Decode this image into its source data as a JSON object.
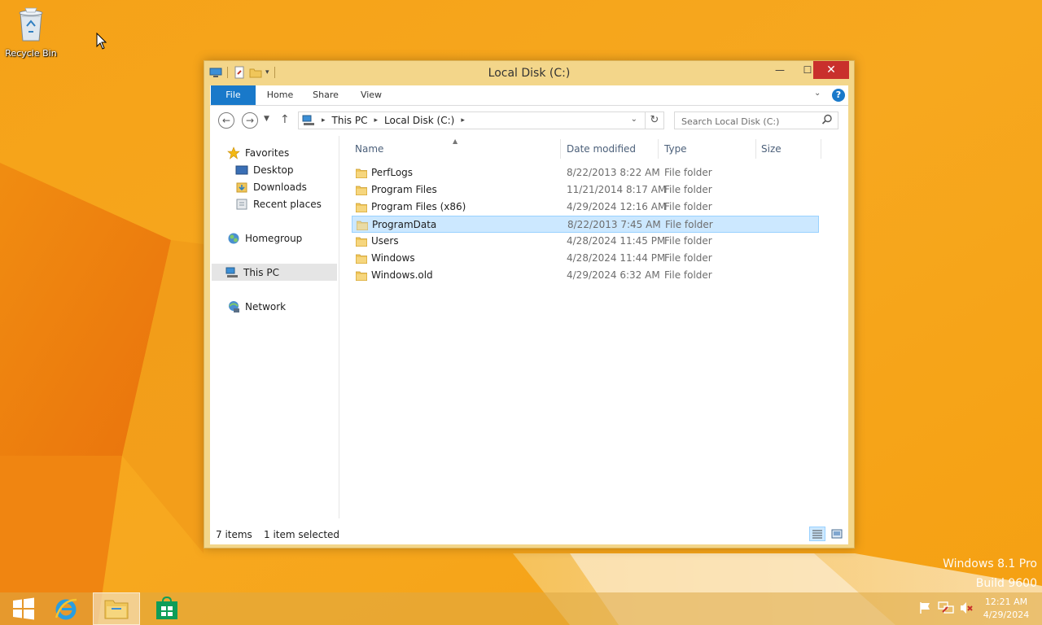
{
  "desktop": {
    "recycle_bin_label": "Recycle Bin",
    "watermark_line1": "Windows 8.1 Pro",
    "watermark_line2": "Build 9600"
  },
  "window": {
    "title": "Local Disk (C:)",
    "controls": {
      "minimize": "—",
      "maximize": "☐",
      "close": "✕"
    }
  },
  "ribbon": {
    "tabs": {
      "file": "File",
      "home": "Home",
      "share": "Share",
      "view": "View"
    },
    "help": "?"
  },
  "navigation": {
    "breadcrumb": [
      "This PC",
      "Local Disk (C:)"
    ],
    "search_placeholder": "Search Local Disk (C:)"
  },
  "nav_pane": {
    "favorites": "Favorites",
    "desktop": "Desktop",
    "downloads": "Downloads",
    "recent_places": "Recent places",
    "homegroup": "Homegroup",
    "this_pc": "This PC",
    "network": "Network"
  },
  "columns": {
    "name": "Name",
    "date": "Date modified",
    "type": "Type",
    "size": "Size"
  },
  "files": [
    {
      "name": "PerfLogs",
      "date": "8/22/2013 8:22 AM",
      "type": "File folder"
    },
    {
      "name": "Program Files",
      "date": "11/21/2014 8:17 AM",
      "type": "File folder"
    },
    {
      "name": "Program Files (x86)",
      "date": "4/29/2024 12:16 AM",
      "type": "File folder"
    },
    {
      "name": "ProgramData",
      "date": "8/22/2013 7:45 AM",
      "type": "File folder",
      "selected": true
    },
    {
      "name": "Users",
      "date": "4/28/2024 11:45 PM",
      "type": "File folder"
    },
    {
      "name": "Windows",
      "date": "4/28/2024 11:44 PM",
      "type": "File folder"
    },
    {
      "name": "Windows.old",
      "date": "4/29/2024 6:32 AM",
      "type": "File folder"
    }
  ],
  "status": {
    "item_count": "7 items",
    "selection": "1 item selected"
  },
  "taskbar": {
    "time": "12:21 AM",
    "date": "4/29/2024"
  },
  "colors": {
    "accent": "#1979ca",
    "selection": "#cce8ff",
    "desktop": "#f6a51b",
    "close": "#c9302c"
  }
}
